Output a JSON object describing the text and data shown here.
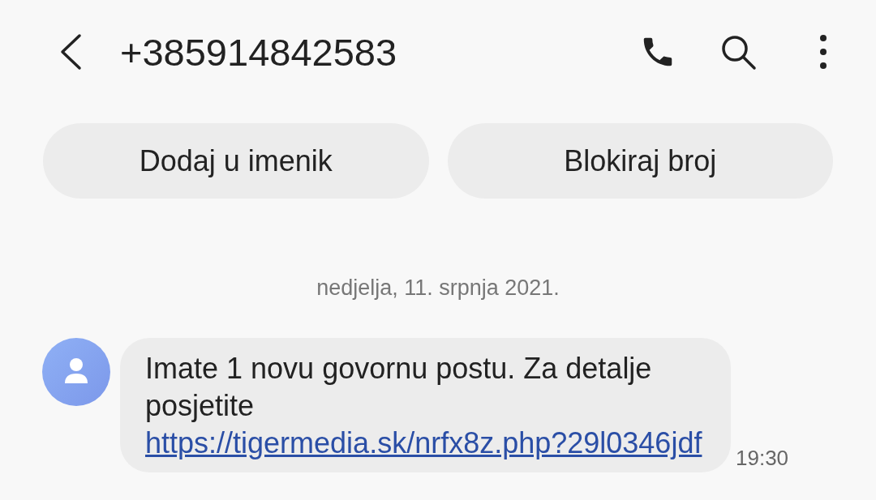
{
  "header": {
    "title": "+385914842583"
  },
  "actions": [
    "Dodaj u imenik",
    "Blokiraj broj"
  ],
  "date": "nedjelja, 11. srpnja 2021.",
  "messages": [
    {
      "text": "Imate 1 novu govornu postu. Za detalje posjetite ",
      "link": "https://tigermedia.sk/nrfx8z.php?29l0346jdf",
      "time": "19:30"
    }
  ]
}
